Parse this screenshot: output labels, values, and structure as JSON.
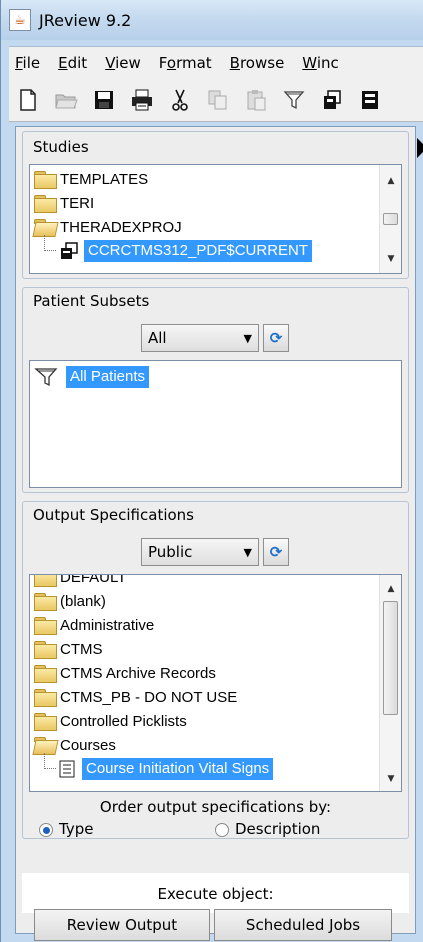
{
  "window": {
    "title": "JReview 9.2"
  },
  "menu": [
    {
      "label": "File",
      "u": "F",
      "rest": "ile"
    },
    {
      "label": "Edit",
      "u": "E",
      "rest": "dit"
    },
    {
      "label": "View",
      "u": "V",
      "rest": "iew"
    },
    {
      "label": "Format",
      "u": "o",
      "pre": "F",
      "rest": "rmat"
    },
    {
      "label": "Browse",
      "u": "B",
      "rest": "rowse"
    },
    {
      "label": "Winc",
      "u": "W",
      "rest": "inc"
    }
  ],
  "toolbar": {
    "icons": [
      "new-icon",
      "open-icon",
      "save-icon",
      "print-icon",
      "cut-icon",
      "copy-icon",
      "paste-icon",
      "filter-icon",
      "objects-icon",
      "table-icon"
    ]
  },
  "studies": {
    "title": "Studies",
    "items": [
      {
        "label": "TEMPLATES",
        "icon": "folder-icon"
      },
      {
        "label": "TERI",
        "icon": "folder-icon"
      },
      {
        "label": "THERADEXPROJ",
        "icon": "folder-open-icon"
      },
      {
        "label": "CCRCTMS312_PDF$CURRENT",
        "icon": "database-icon",
        "selected": true
      }
    ]
  },
  "patient_subsets": {
    "title": "Patient Subsets",
    "filter_value": "All",
    "items": [
      {
        "label": "All Patients",
        "icon": "filter-icon",
        "selected": true
      }
    ]
  },
  "output_specs": {
    "title": "Output Specifications",
    "filter_value": "Public",
    "items": [
      {
        "label": "DEFAULT",
        "icon": "folder-icon"
      },
      {
        "label": "(blank)",
        "icon": "folder-icon"
      },
      {
        "label": "Administrative",
        "icon": "folder-icon"
      },
      {
        "label": "CTMS",
        "icon": "folder-icon"
      },
      {
        "label": "CTMS Archive Records",
        "icon": "folder-icon"
      },
      {
        "label": "CTMS_PB - DO NOT USE",
        "icon": "folder-icon"
      },
      {
        "label": "Controlled Picklists",
        "icon": "folder-icon"
      },
      {
        "label": "Courses",
        "icon": "folder-open-icon"
      },
      {
        "label": "Course Initiation Vital Signs",
        "icon": "report-icon",
        "selected": true
      }
    ],
    "order_by_label": "Order output specifications by:",
    "order_options": [
      {
        "label": "Type",
        "selected": true
      },
      {
        "label": "Description",
        "selected": false
      }
    ]
  },
  "execute": {
    "label": "Execute object:",
    "buttons": [
      "Review Output",
      "Scheduled Jobs"
    ]
  },
  "colors": {
    "selection": "#3399ff",
    "refresh_icon": "#1d6fc9"
  }
}
